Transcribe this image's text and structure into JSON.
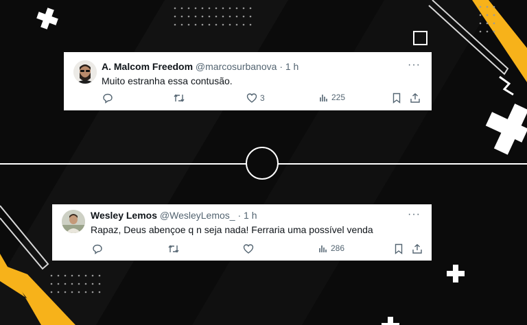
{
  "colors": {
    "background": "#0b0b0b",
    "accent": "#f7b21a",
    "card": "#ffffff",
    "muted": "#536471"
  },
  "tweets": [
    {
      "name": "A. Malcom Freedom",
      "handle": "@marcosurbanova",
      "separator": "·",
      "time": "1 h",
      "text": "Muito estranha essa contusão.",
      "more": "···",
      "likes": "3",
      "views": "225",
      "icons": [
        "reply-icon",
        "retweet-icon",
        "like-icon",
        "views-icon",
        "bookmark-icon",
        "share-icon"
      ]
    },
    {
      "name": "Wesley Lemos",
      "handle": "@WesleyLemos_",
      "separator": "·",
      "time": "1 h",
      "text": "Rapaz, Deus abençoe q n seja nada! Ferraria uma possível venda",
      "more": "···",
      "views": "286",
      "icons": [
        "reply-icon",
        "retweet-icon",
        "like-icon",
        "views-icon",
        "bookmark-icon",
        "share-icon"
      ]
    }
  ]
}
